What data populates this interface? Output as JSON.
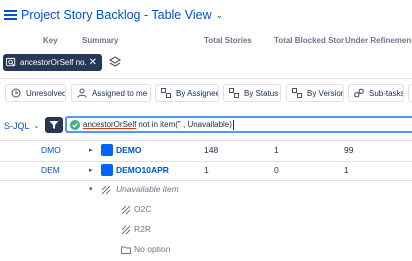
{
  "header": {
    "title": "Project Story Backlog - Table View",
    "title_chevron": "⌄",
    "columns": {
      "key": "Key",
      "summary": "Summary",
      "total_stories": "Total Stories",
      "total_blocked": "Total Blocked Stor",
      "under_refinement": "Under Refinemen"
    }
  },
  "active_filter": {
    "label": "ancestorOrSelf no...",
    "close_glyph": "✕"
  },
  "quick_filters": [
    {
      "label": "Unresolved"
    },
    {
      "label": "Assigned to me"
    },
    {
      "label": "By Assignee"
    },
    {
      "label": "By Status"
    },
    {
      "label": "By Version"
    },
    {
      "label": "Sub-tasks"
    }
  ],
  "query_bar": {
    "mode_label": "S-JQL",
    "mode_chevron": "⌄",
    "query_func": "ancestorOrSelf",
    "query_rest": "not in item(\" , Unavailable)"
  },
  "rows": [
    {
      "key": "DMO",
      "expander": "▸",
      "name": "DEMO",
      "total_stories": "148",
      "total_blocked": "1",
      "under_refinement": "99"
    },
    {
      "key": "DEM",
      "expander": "▸",
      "name": "DEMO10APR",
      "total_stories": "1",
      "total_blocked": "0",
      "under_refinement": "1"
    }
  ],
  "unavailable_group": {
    "expander": "▾",
    "label": "Unavailable item",
    "children": [
      {
        "label": "O2C"
      },
      {
        "label": "R2R"
      },
      {
        "label": "No option"
      }
    ]
  },
  "colors": {
    "link": "#0052cc",
    "dark_chip": "#253858",
    "focus_border": "#4c9aff",
    "project_icon": "#0065ff",
    "valid_check": "#36b37e"
  }
}
